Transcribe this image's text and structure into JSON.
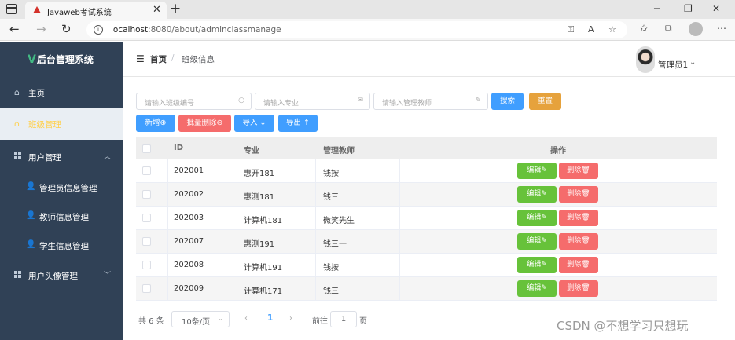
{
  "browser": {
    "tab_title": "Javaweb考试系统",
    "url_host": "localhost",
    "url_rest": ":8080/about/adminclassmanage"
  },
  "sidebar": {
    "logo_letter": "V",
    "logo_text": "后台管理系统",
    "items": [
      {
        "label": "主页",
        "icon": "home-icon"
      },
      {
        "label": "班级管理",
        "icon": "class-icon",
        "active": true
      },
      {
        "label": "用户管理",
        "icon": "grid-icon",
        "expanded": true
      },
      {
        "label": "管理员信息管理",
        "icon": "user-icon"
      },
      {
        "label": "教师信息管理",
        "icon": "user-icon"
      },
      {
        "label": "学生信息管理",
        "icon": "user-icon"
      },
      {
        "label": "用户头像管理",
        "icon": "grid-icon"
      }
    ],
    "accent_color": "#ffd04b",
    "background_color": "#304156"
  },
  "header": {
    "breadcrumb_home": "首页",
    "breadcrumb_sep": "/",
    "breadcrumb_current": "班级信息",
    "username": "管理员1"
  },
  "filters": {
    "class_id_placeholder": "请输入班级编号",
    "major_placeholder": "请输入专业",
    "teacher_placeholder": "请输入管理教师",
    "search_label": "搜索",
    "reset_label": "重置"
  },
  "actions": {
    "add_label": "新增⊕",
    "batch_delete_label": "批量删除⊖",
    "import_label": "导入 ↓",
    "export_label": "导出 ↑"
  },
  "table": {
    "headers": {
      "id": "ID",
      "major": "专业",
      "teacher": "管理教师",
      "ops": "操作"
    },
    "edit_label": "编辑✎",
    "delete_label": "删除🗑",
    "rows": [
      {
        "id": "202001",
        "major": "惠开181",
        "teacher": "钱按"
      },
      {
        "id": "202002",
        "major": "惠测181",
        "teacher": "钱三"
      },
      {
        "id": "202003",
        "major": "计算机181",
        "teacher": "微笑先生"
      },
      {
        "id": "202007",
        "major": "惠测191",
        "teacher": "钱三一"
      },
      {
        "id": "202008",
        "major": "计算机191",
        "teacher": "钱按"
      },
      {
        "id": "202009",
        "major": "计算机171",
        "teacher": "钱三"
      }
    ]
  },
  "pagination": {
    "total_text": "共 6 条",
    "page_size": "10条/页",
    "current_page": "1",
    "goto_prefix": "前往",
    "goto_value": "1",
    "goto_suffix": "页"
  },
  "watermark": "CSDN @不想学习只想玩"
}
